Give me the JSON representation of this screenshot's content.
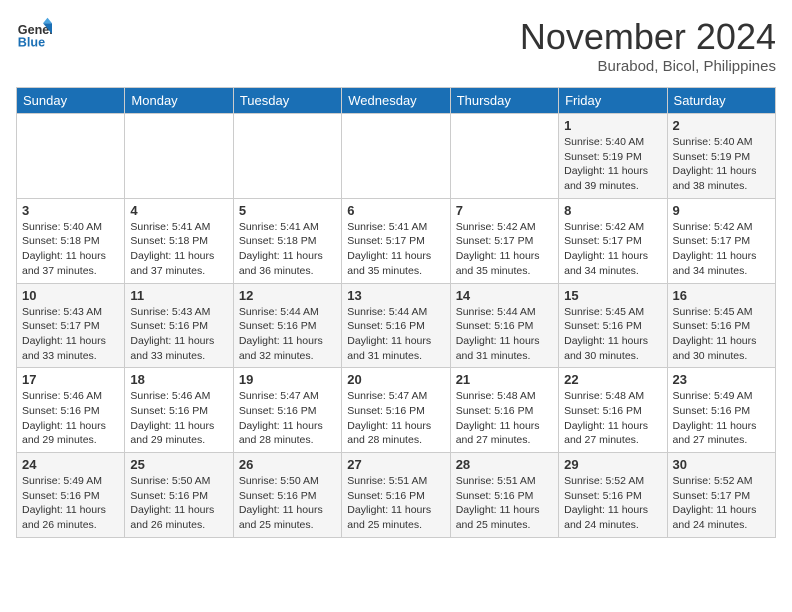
{
  "logo": {
    "line1": "General",
    "line2": "Blue"
  },
  "title": "November 2024",
  "location": "Burabod, Bicol, Philippines",
  "weekdays": [
    "Sunday",
    "Monday",
    "Tuesday",
    "Wednesday",
    "Thursday",
    "Friday",
    "Saturday"
  ],
  "weeks": [
    [
      {
        "day": "",
        "sunrise": "",
        "sunset": "",
        "daylight": ""
      },
      {
        "day": "",
        "sunrise": "",
        "sunset": "",
        "daylight": ""
      },
      {
        "day": "",
        "sunrise": "",
        "sunset": "",
        "daylight": ""
      },
      {
        "day": "",
        "sunrise": "",
        "sunset": "",
        "daylight": ""
      },
      {
        "day": "",
        "sunrise": "",
        "sunset": "",
        "daylight": ""
      },
      {
        "day": "1",
        "sunrise": "Sunrise: 5:40 AM",
        "sunset": "Sunset: 5:19 PM",
        "daylight": "Daylight: 11 hours and 39 minutes."
      },
      {
        "day": "2",
        "sunrise": "Sunrise: 5:40 AM",
        "sunset": "Sunset: 5:19 PM",
        "daylight": "Daylight: 11 hours and 38 minutes."
      }
    ],
    [
      {
        "day": "3",
        "sunrise": "Sunrise: 5:40 AM",
        "sunset": "Sunset: 5:18 PM",
        "daylight": "Daylight: 11 hours and 37 minutes."
      },
      {
        "day": "4",
        "sunrise": "Sunrise: 5:41 AM",
        "sunset": "Sunset: 5:18 PM",
        "daylight": "Daylight: 11 hours and 37 minutes."
      },
      {
        "day": "5",
        "sunrise": "Sunrise: 5:41 AM",
        "sunset": "Sunset: 5:18 PM",
        "daylight": "Daylight: 11 hours and 36 minutes."
      },
      {
        "day": "6",
        "sunrise": "Sunrise: 5:41 AM",
        "sunset": "Sunset: 5:17 PM",
        "daylight": "Daylight: 11 hours and 35 minutes."
      },
      {
        "day": "7",
        "sunrise": "Sunrise: 5:42 AM",
        "sunset": "Sunset: 5:17 PM",
        "daylight": "Daylight: 11 hours and 35 minutes."
      },
      {
        "day": "8",
        "sunrise": "Sunrise: 5:42 AM",
        "sunset": "Sunset: 5:17 PM",
        "daylight": "Daylight: 11 hours and 34 minutes."
      },
      {
        "day": "9",
        "sunrise": "Sunrise: 5:42 AM",
        "sunset": "Sunset: 5:17 PM",
        "daylight": "Daylight: 11 hours and 34 minutes."
      }
    ],
    [
      {
        "day": "10",
        "sunrise": "Sunrise: 5:43 AM",
        "sunset": "Sunset: 5:17 PM",
        "daylight": "Daylight: 11 hours and 33 minutes."
      },
      {
        "day": "11",
        "sunrise": "Sunrise: 5:43 AM",
        "sunset": "Sunset: 5:16 PM",
        "daylight": "Daylight: 11 hours and 33 minutes."
      },
      {
        "day": "12",
        "sunrise": "Sunrise: 5:44 AM",
        "sunset": "Sunset: 5:16 PM",
        "daylight": "Daylight: 11 hours and 32 minutes."
      },
      {
        "day": "13",
        "sunrise": "Sunrise: 5:44 AM",
        "sunset": "Sunset: 5:16 PM",
        "daylight": "Daylight: 11 hours and 31 minutes."
      },
      {
        "day": "14",
        "sunrise": "Sunrise: 5:44 AM",
        "sunset": "Sunset: 5:16 PM",
        "daylight": "Daylight: 11 hours and 31 minutes."
      },
      {
        "day": "15",
        "sunrise": "Sunrise: 5:45 AM",
        "sunset": "Sunset: 5:16 PM",
        "daylight": "Daylight: 11 hours and 30 minutes."
      },
      {
        "day": "16",
        "sunrise": "Sunrise: 5:45 AM",
        "sunset": "Sunset: 5:16 PM",
        "daylight": "Daylight: 11 hours and 30 minutes."
      }
    ],
    [
      {
        "day": "17",
        "sunrise": "Sunrise: 5:46 AM",
        "sunset": "Sunset: 5:16 PM",
        "daylight": "Daylight: 11 hours and 29 minutes."
      },
      {
        "day": "18",
        "sunrise": "Sunrise: 5:46 AM",
        "sunset": "Sunset: 5:16 PM",
        "daylight": "Daylight: 11 hours and 29 minutes."
      },
      {
        "day": "19",
        "sunrise": "Sunrise: 5:47 AM",
        "sunset": "Sunset: 5:16 PM",
        "daylight": "Daylight: 11 hours and 28 minutes."
      },
      {
        "day": "20",
        "sunrise": "Sunrise: 5:47 AM",
        "sunset": "Sunset: 5:16 PM",
        "daylight": "Daylight: 11 hours and 28 minutes."
      },
      {
        "day": "21",
        "sunrise": "Sunrise: 5:48 AM",
        "sunset": "Sunset: 5:16 PM",
        "daylight": "Daylight: 11 hours and 27 minutes."
      },
      {
        "day": "22",
        "sunrise": "Sunrise: 5:48 AM",
        "sunset": "Sunset: 5:16 PM",
        "daylight": "Daylight: 11 hours and 27 minutes."
      },
      {
        "day": "23",
        "sunrise": "Sunrise: 5:49 AM",
        "sunset": "Sunset: 5:16 PM",
        "daylight": "Daylight: 11 hours and 27 minutes."
      }
    ],
    [
      {
        "day": "24",
        "sunrise": "Sunrise: 5:49 AM",
        "sunset": "Sunset: 5:16 PM",
        "daylight": "Daylight: 11 hours and 26 minutes."
      },
      {
        "day": "25",
        "sunrise": "Sunrise: 5:50 AM",
        "sunset": "Sunset: 5:16 PM",
        "daylight": "Daylight: 11 hours and 26 minutes."
      },
      {
        "day": "26",
        "sunrise": "Sunrise: 5:50 AM",
        "sunset": "Sunset: 5:16 PM",
        "daylight": "Daylight: 11 hours and 25 minutes."
      },
      {
        "day": "27",
        "sunrise": "Sunrise: 5:51 AM",
        "sunset": "Sunset: 5:16 PM",
        "daylight": "Daylight: 11 hours and 25 minutes."
      },
      {
        "day": "28",
        "sunrise": "Sunrise: 5:51 AM",
        "sunset": "Sunset: 5:16 PM",
        "daylight": "Daylight: 11 hours and 25 minutes."
      },
      {
        "day": "29",
        "sunrise": "Sunrise: 5:52 AM",
        "sunset": "Sunset: 5:16 PM",
        "daylight": "Daylight: 11 hours and 24 minutes."
      },
      {
        "day": "30",
        "sunrise": "Sunrise: 5:52 AM",
        "sunset": "Sunset: 5:17 PM",
        "daylight": "Daylight: 11 hours and 24 minutes."
      }
    ]
  ]
}
